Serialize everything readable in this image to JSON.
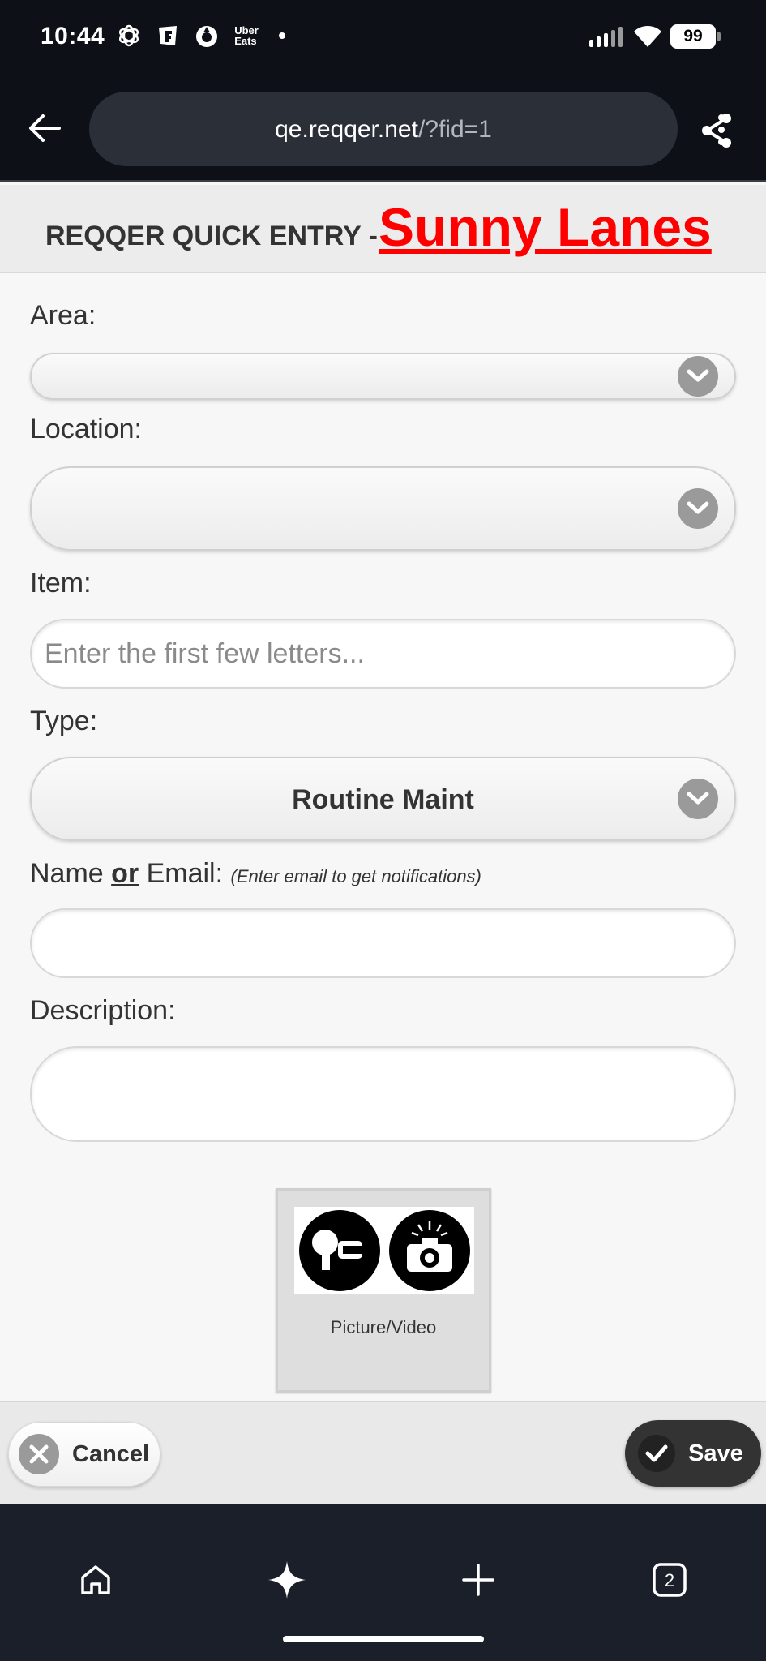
{
  "status_bar": {
    "time": "10:44",
    "notification_icons": [
      "openai-icon",
      "fandango-icon",
      "drop-icon",
      "uber-eats-icon"
    ],
    "uber_eats_label_top": "Uber",
    "uber_eats_label_bottom": "Eats",
    "battery": "99"
  },
  "browser": {
    "url_host": "qe.reqqer.net",
    "url_path": "/?fid=1",
    "tab_count": "2"
  },
  "header": {
    "prefix": "REQQER QUICK ENTRY -",
    "brand": "Sunny Lanes",
    "brand_color": "#ff0000"
  },
  "form": {
    "area_label": "Area:",
    "area_value": "",
    "location_label": "Location:",
    "location_value": "",
    "item_label": "Item:",
    "item_placeholder": "Enter the first few letters...",
    "type_label": "Type:",
    "type_value": "Routine Maint",
    "name_label_start": "Name ",
    "name_label_or": "or",
    "name_label_end": " Email:",
    "name_hint": "(Enter email to get notifications)",
    "description_label": "Description:",
    "media_label": "Picture/Video"
  },
  "actions": {
    "cancel_label": "Cancel",
    "save_label": "Save"
  }
}
